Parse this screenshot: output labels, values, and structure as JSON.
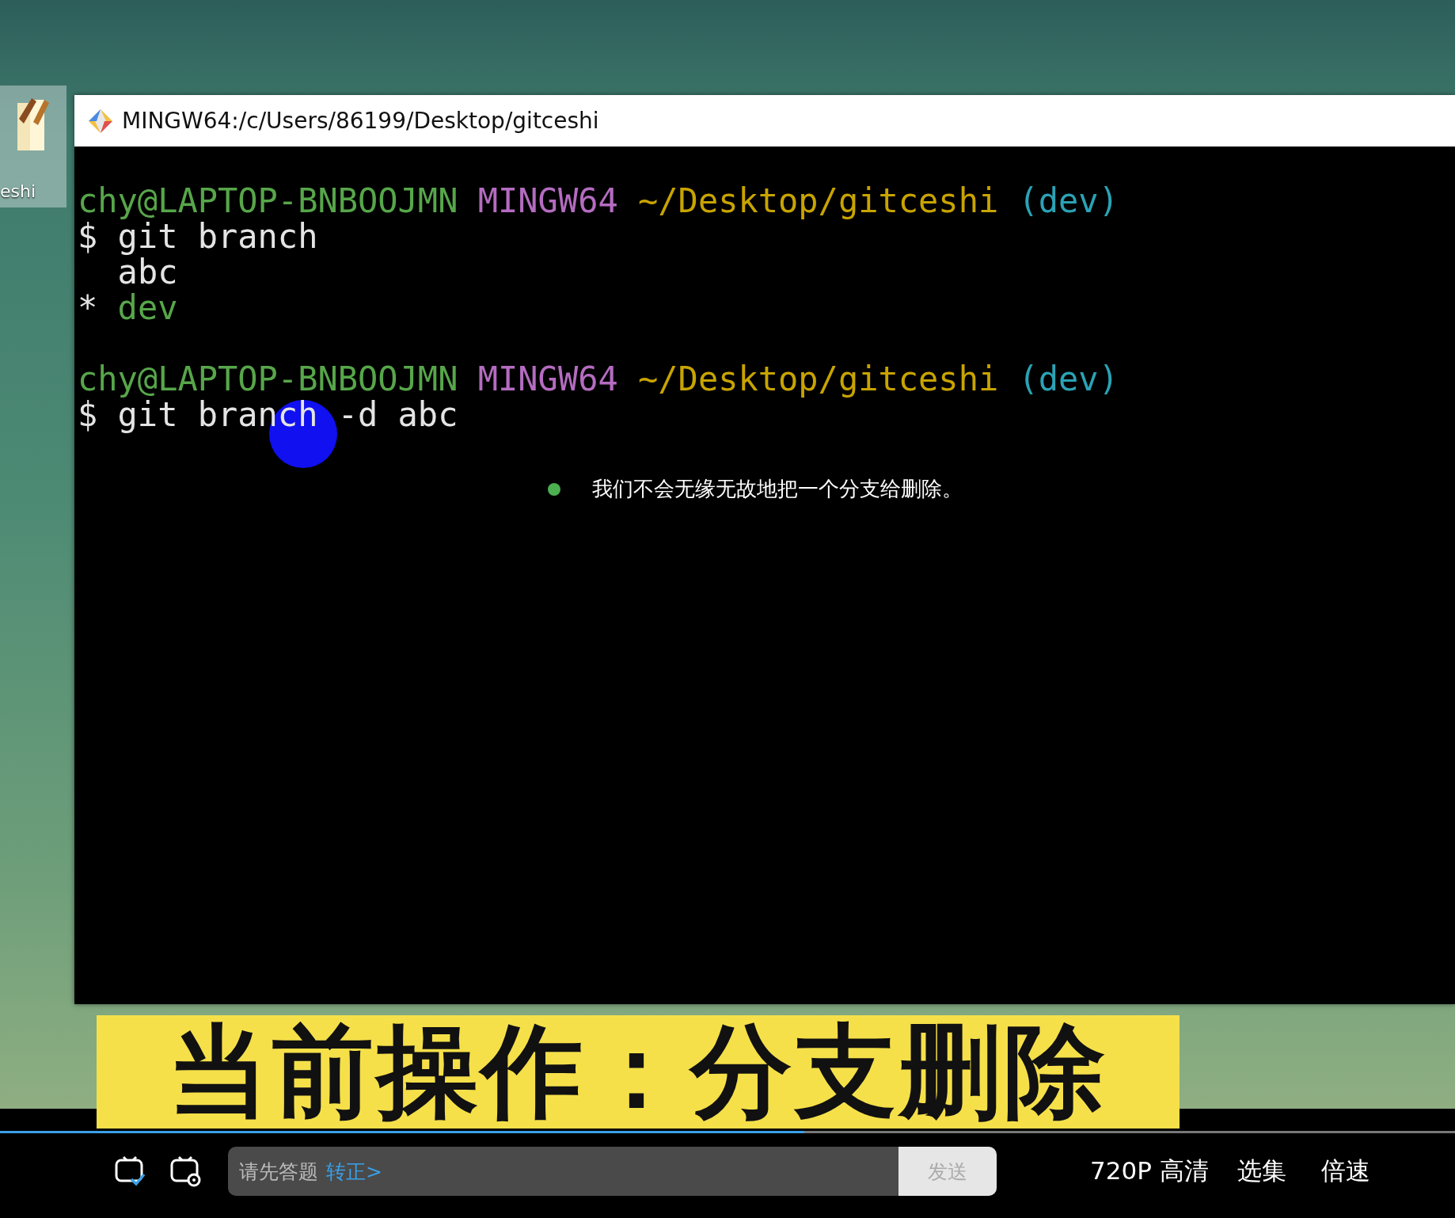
{
  "desktop_icon": {
    "label": "eshi"
  },
  "window": {
    "title": "MINGW64:/c/Users/86199/Desktop/gitceshi"
  },
  "terminal": {
    "lines": [
      {
        "kind": "prompt",
        "user": "chy@LAPTOP-BNBOOJMN",
        "system": "MINGW64",
        "path": "~/Desktop/gitceshi",
        "branch": "(dev)"
      },
      {
        "kind": "command",
        "text": "$ git branch"
      },
      {
        "kind": "branch",
        "name": "abc",
        "current": false
      },
      {
        "kind": "branch",
        "marker": "*",
        "name": "dev",
        "current": true
      },
      {
        "kind": "blank"
      },
      {
        "kind": "prompt",
        "user": "chy@LAPTOP-BNBOOJMN",
        "system": "MINGW64",
        "path": "~/Desktop/gitceshi",
        "branch": "(dev)"
      },
      {
        "kind": "command",
        "text": "$ git branch -d abc"
      }
    ]
  },
  "subtitle": {
    "text": "我们不会无缘无故地把一个分支给删除。"
  },
  "banner": {
    "text": "当前操作：分支删除"
  },
  "player": {
    "progress": {
      "level": 0.553
    },
    "comment": {
      "placeholder": "请先答题",
      "link": "转正>",
      "send": "发送"
    },
    "controls": [
      "720P 高清",
      "选集",
      "倍速"
    ]
  }
}
